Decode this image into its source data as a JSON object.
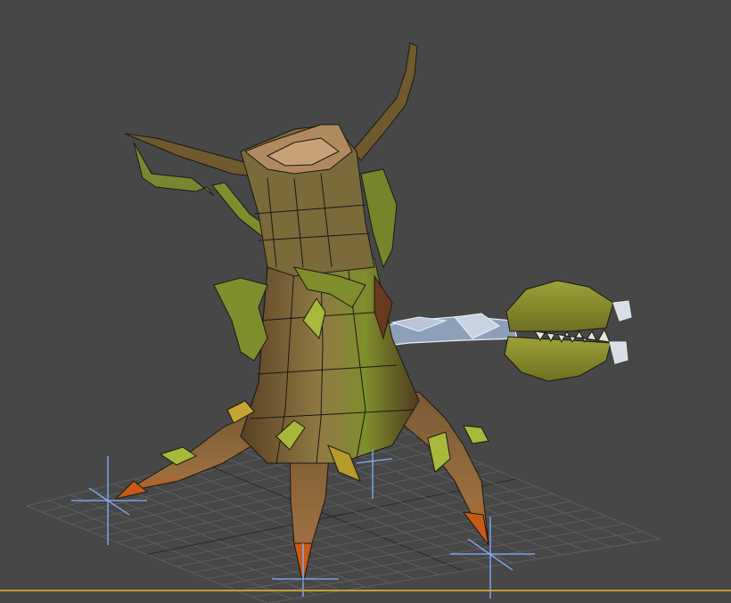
{
  "viewport": {
    "background": "#474747",
    "grid_color": "#5e5e5e",
    "grid_major_color": "#2a2a2a",
    "gizmo_color": "#7fb2ff",
    "baseline_color": "#c89b3a",
    "wire_color": "#1a1a14",
    "selection_color": "#e8f0ff"
  },
  "model": {
    "bark_light": "#8f7a45",
    "bark_dark": "#5a4022",
    "moss": "#7f8d2c",
    "leaf": "#a7b83a",
    "claw": "#c85a18",
    "flytrap": "#8a8f2e"
  }
}
